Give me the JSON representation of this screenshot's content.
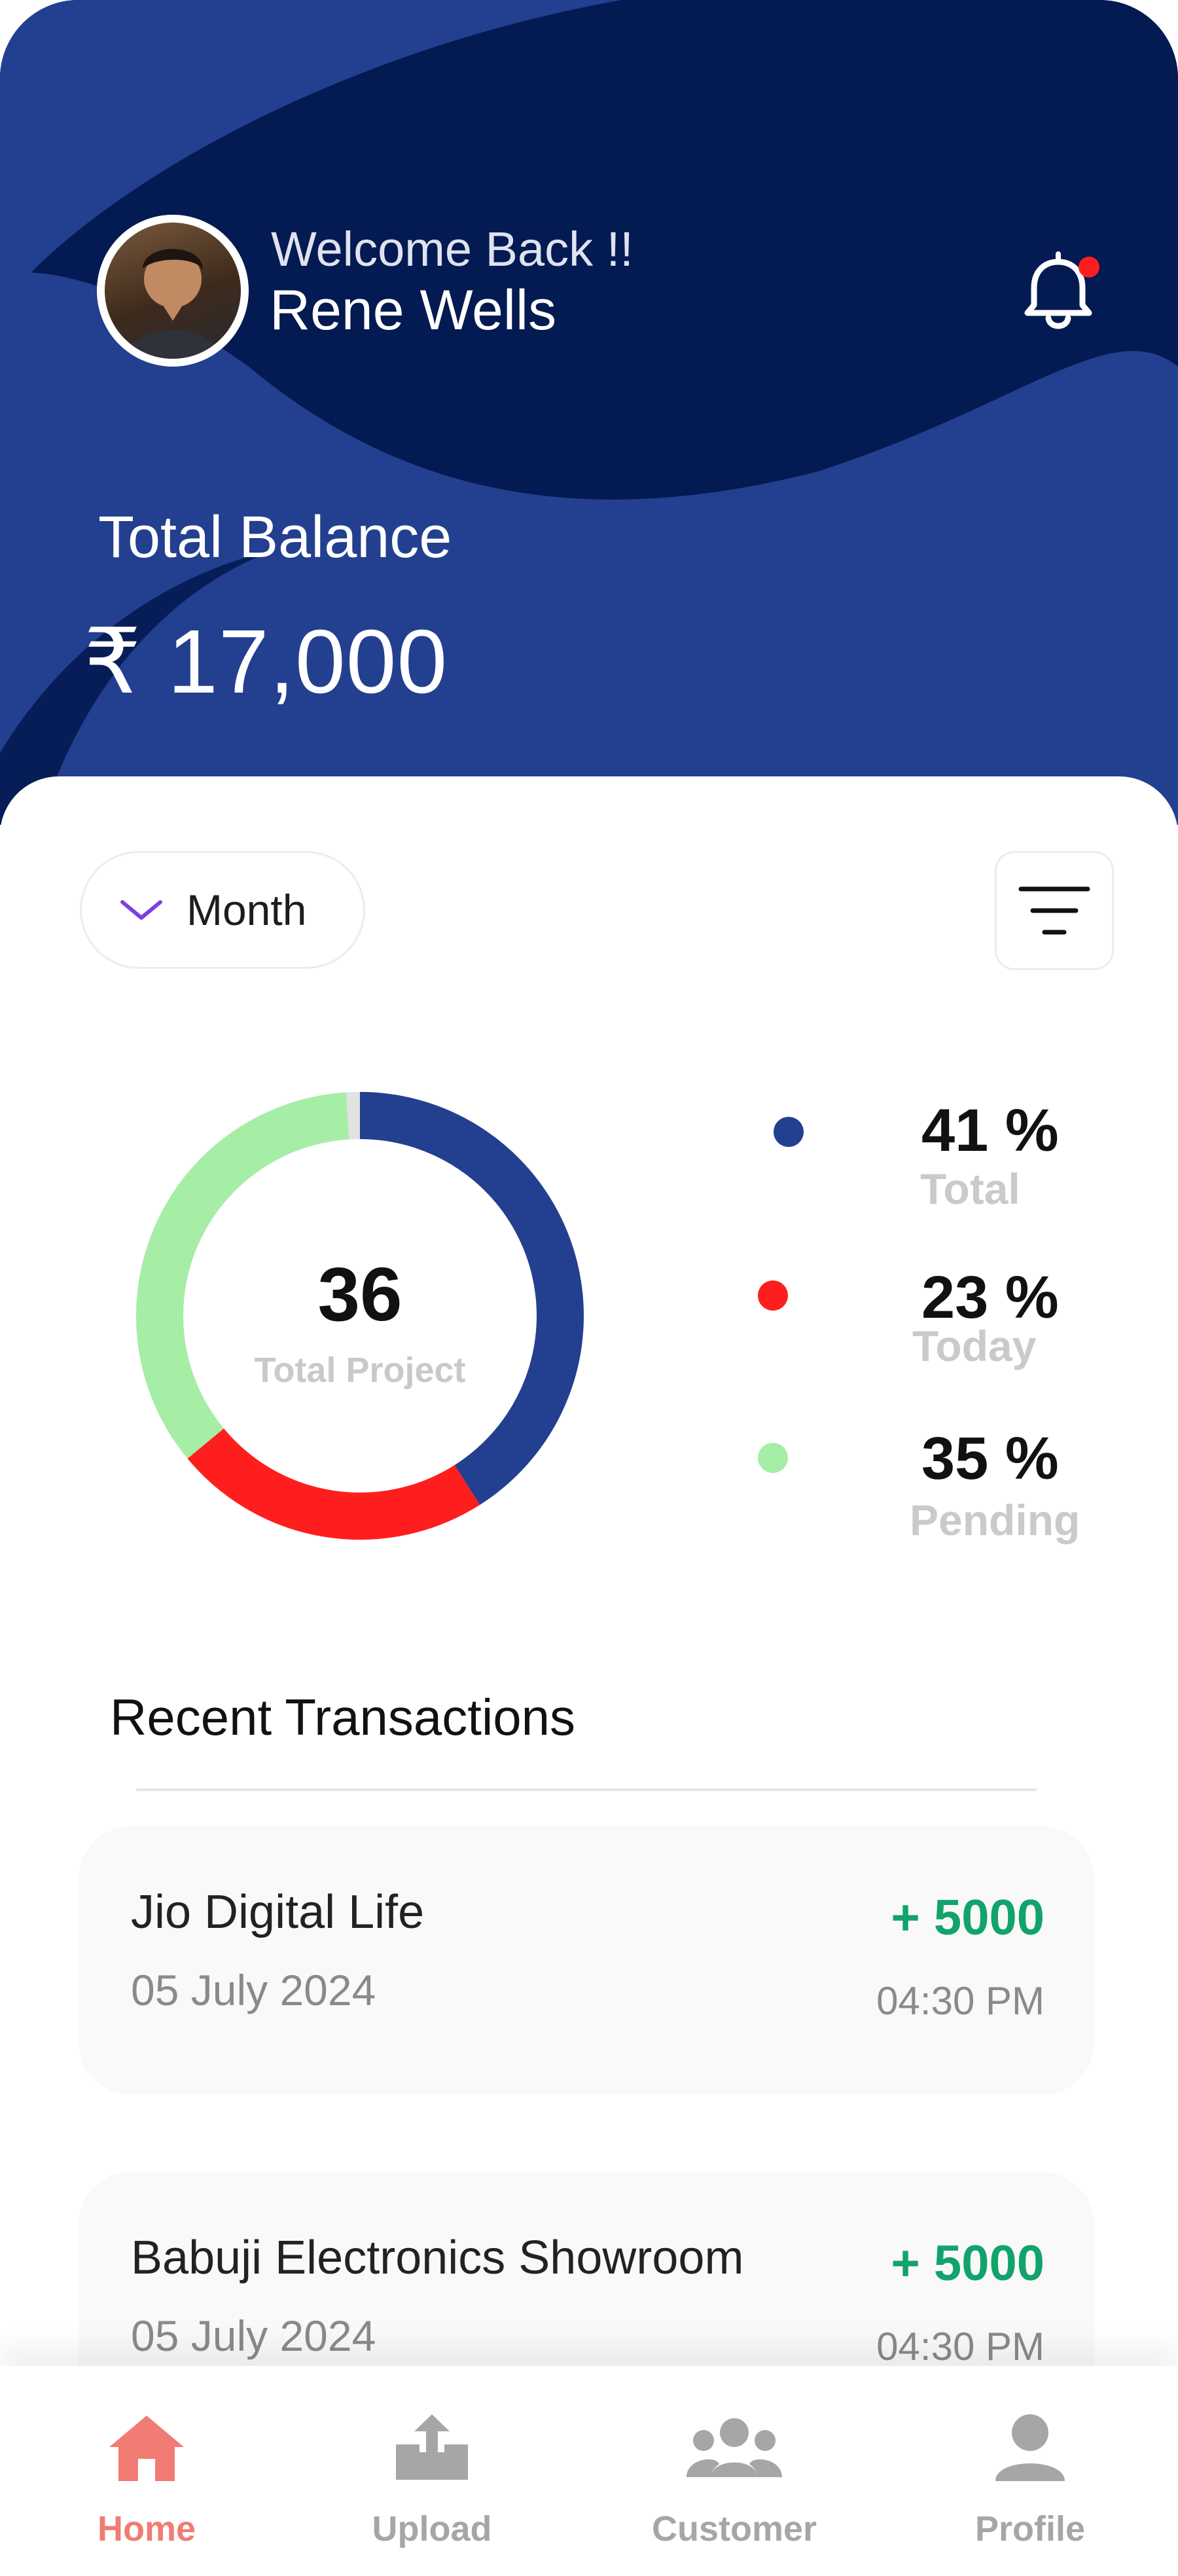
{
  "header": {
    "welcome": "Welcome Back !!",
    "user_name": "Rene Wells",
    "balance_label": "Total Balance",
    "balance_value": "₹ 17,000",
    "notification_dot_color": "#ff1e1e"
  },
  "filters": {
    "period": "Month"
  },
  "summary": {
    "total_projects": "36",
    "total_projects_label": "Total Project",
    "legend": [
      {
        "percent": "41 %",
        "label": "Total",
        "color": "#233f8f"
      },
      {
        "percent": "23 %",
        "label": "Today",
        "color": "#ff1e1e"
      },
      {
        "percent": "35 %",
        "label": "Pending",
        "color": "#a6eda6"
      }
    ]
  },
  "chart_data": {
    "type": "pie",
    "subtype": "donut",
    "center_value": 36,
    "center_label": "Total Project",
    "series": [
      {
        "name": "Total",
        "value": 41,
        "color": "#233f8f"
      },
      {
        "name": "Today",
        "value": 23,
        "color": "#ff1e1e"
      },
      {
        "name": "Pending",
        "value": 35,
        "color": "#a6eda6"
      }
    ],
    "remainder_color": "#dfe4e0"
  },
  "transactions": {
    "title": "Recent Transactions",
    "items": [
      {
        "name": "Jio Digital Life",
        "date": "05 July 2024",
        "amount": "+ 5000",
        "time": "04:30 PM"
      },
      {
        "name": "Babuji Electronics Showroom",
        "date": "05 July 2024",
        "amount": "+ 5000",
        "time": "04:30 PM"
      }
    ]
  },
  "nav": {
    "items": [
      {
        "label": "Home",
        "icon": "home-icon",
        "active": true
      },
      {
        "label": "Upload",
        "icon": "upload-icon",
        "active": false
      },
      {
        "label": "Customer",
        "icon": "customer-icon",
        "active": false
      },
      {
        "label": "Profile",
        "icon": "profile-icon",
        "active": false
      }
    ],
    "active_color": "#f07c74",
    "inactive_color": "#a6a6a6"
  }
}
